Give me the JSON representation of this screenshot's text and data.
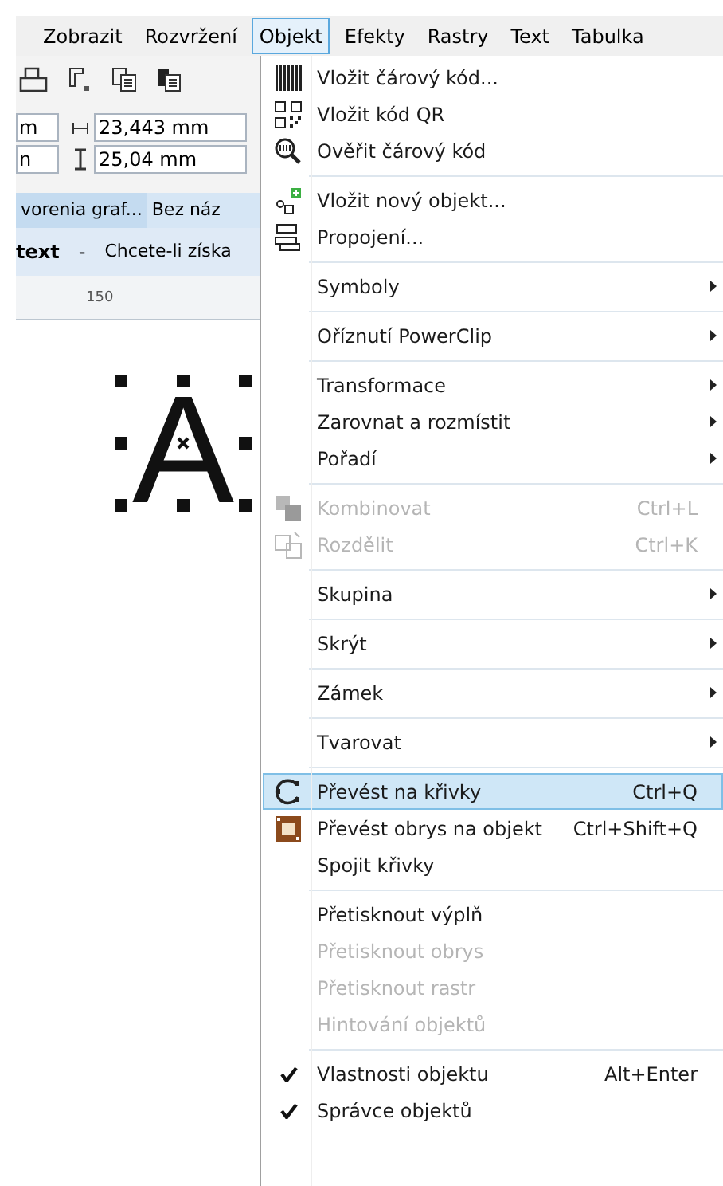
{
  "menubar": [
    {
      "label": "Zobrazit",
      "selected": false
    },
    {
      "label": "Rozvržení",
      "selected": false
    },
    {
      "label": "Objekt",
      "selected": true
    },
    {
      "label": "Efekty",
      "selected": false
    },
    {
      "label": "Rastry",
      "selected": false
    },
    {
      "label": "Text",
      "selected": false
    },
    {
      "label": "Tabulka",
      "selected": false
    }
  ],
  "property_bar": {
    "fields": [
      {
        "value": "m"
      },
      {
        "value": "n"
      }
    ],
    "size_fields": [
      {
        "value": "23,443 mm"
      },
      {
        "value": "25,04 mm"
      }
    ]
  },
  "document_tabs": [
    {
      "label": "vorenia graf...",
      "selected": true
    },
    {
      "label": "Bez náz",
      "selected": false
    }
  ],
  "hint_bar": {
    "tool": "text",
    "separator": "-",
    "hint": "Chcete-li získa"
  },
  "ruler": {
    "label": "150"
  },
  "canvas": {
    "text_object": "A"
  },
  "menu": [
    {
      "kind": "item",
      "label": "Vložit  čárový kód...",
      "disabled": false,
      "submenu": false,
      "checked": false,
      "selected": false
    },
    {
      "kind": "item",
      "label": "Vložit kód QR",
      "disabled": false,
      "submenu": false,
      "checked": false,
      "selected": false
    },
    {
      "kind": "item",
      "label": "Ověřit čárový kód",
      "disabled": false,
      "submenu": false,
      "checked": false,
      "selected": false
    },
    {
      "kind": "separator"
    },
    {
      "kind": "item",
      "label": "Vložit nový objekt...",
      "disabled": false,
      "submenu": false,
      "checked": false,
      "selected": false
    },
    {
      "kind": "item",
      "label": "Propojení...",
      "disabled": false,
      "submenu": false,
      "checked": false,
      "selected": false
    },
    {
      "kind": "separator"
    },
    {
      "kind": "item",
      "label": "Symboly",
      "disabled": false,
      "submenu": true,
      "checked": false,
      "selected": false
    },
    {
      "kind": "separator"
    },
    {
      "kind": "item",
      "label": "Oříznutí PowerClip",
      "disabled": false,
      "submenu": true,
      "checked": false,
      "selected": false
    },
    {
      "kind": "separator"
    },
    {
      "kind": "item",
      "label": "Transformace",
      "disabled": false,
      "submenu": true,
      "checked": false,
      "selected": false
    },
    {
      "kind": "item",
      "label": "Zarovnat a rozmístit",
      "disabled": false,
      "submenu": true,
      "checked": false,
      "selected": false
    },
    {
      "kind": "item",
      "label": "Pořadí",
      "disabled": false,
      "submenu": true,
      "checked": false,
      "selected": false
    },
    {
      "kind": "separator"
    },
    {
      "kind": "item",
      "label": "Kombinovat",
      "shortcut": "Ctrl+L",
      "disabled": true,
      "submenu": false,
      "checked": false,
      "selected": false
    },
    {
      "kind": "item",
      "label": "Rozdělit",
      "shortcut": "Ctrl+K",
      "disabled": true,
      "submenu": false,
      "checked": false,
      "selected": false
    },
    {
      "kind": "separator"
    },
    {
      "kind": "item",
      "label": "Skupina",
      "disabled": false,
      "submenu": true,
      "checked": false,
      "selected": false
    },
    {
      "kind": "separator"
    },
    {
      "kind": "item",
      "label": "Skrýt",
      "disabled": false,
      "submenu": true,
      "checked": false,
      "selected": false
    },
    {
      "kind": "separator"
    },
    {
      "kind": "item",
      "label": "Zámek",
      "disabled": false,
      "submenu": true,
      "checked": false,
      "selected": false
    },
    {
      "kind": "separator"
    },
    {
      "kind": "item",
      "label": "Tvarovat",
      "disabled": false,
      "submenu": true,
      "checked": false,
      "selected": false
    },
    {
      "kind": "separator"
    },
    {
      "kind": "item",
      "label": "Převést na křivky",
      "shortcut": "Ctrl+Q",
      "disabled": false,
      "submenu": false,
      "checked": false,
      "selected": true
    },
    {
      "kind": "item",
      "label": "Převést obrys na objekt",
      "shortcut": "Ctrl+Shift+Q",
      "disabled": false,
      "submenu": false,
      "checked": false,
      "selected": false
    },
    {
      "kind": "item",
      "label": "Spojit křivky",
      "disabled": false,
      "submenu": false,
      "checked": false,
      "selected": false
    },
    {
      "kind": "separator"
    },
    {
      "kind": "item",
      "label": "Přetisknout výplň",
      "disabled": false,
      "submenu": false,
      "checked": false,
      "selected": false
    },
    {
      "kind": "item",
      "label": "Přetisknout obrys",
      "disabled": true,
      "submenu": false,
      "checked": false,
      "selected": false
    },
    {
      "kind": "item",
      "label": "Přetisknout rastr",
      "disabled": true,
      "submenu": false,
      "checked": false,
      "selected": false
    },
    {
      "kind": "item",
      "label": "Hintování objektů",
      "disabled": true,
      "submenu": false,
      "checked": false,
      "selected": false
    },
    {
      "kind": "separator"
    },
    {
      "kind": "item",
      "label": "Vlastnosti objektu",
      "shortcut": "Alt+Enter",
      "disabled": false,
      "submenu": false,
      "checked": true,
      "selected": false
    },
    {
      "kind": "item",
      "label": "Správce objektů",
      "disabled": false,
      "submenu": false,
      "checked": true,
      "selected": false
    }
  ]
}
